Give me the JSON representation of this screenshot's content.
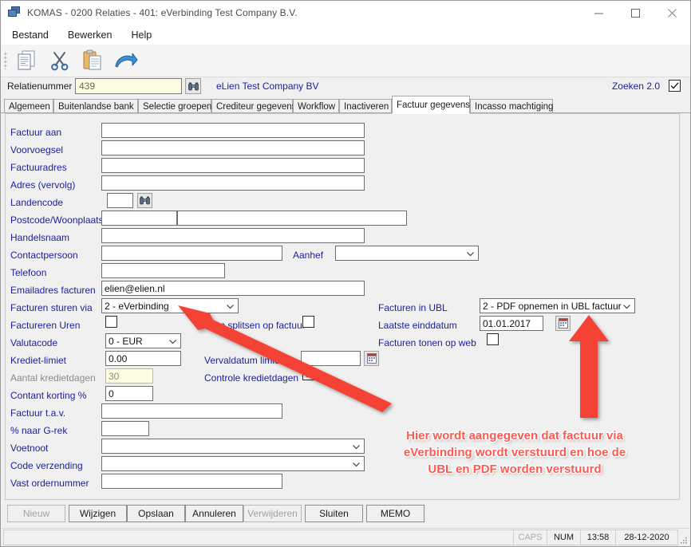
{
  "window": {
    "title": "KOMAS - 0200 Relaties - 401: eVerbinding Test Company B.V.",
    "icon": "app-window-icon",
    "minimize": "—",
    "maximize": "□",
    "close": "✕"
  },
  "menu": {
    "items": [
      {
        "label": "Bestand"
      },
      {
        "label": "Bewerken"
      },
      {
        "label": "Help"
      }
    ]
  },
  "toolbar": {
    "buttons": [
      {
        "name": "copy-documents-icon"
      },
      {
        "name": "scissors-cut-icon"
      },
      {
        "name": "clipboard-paste-icon"
      },
      {
        "name": "blue-arrow-undo-icon"
      }
    ]
  },
  "relation": {
    "label": "Relatienummer",
    "value": "439",
    "placeholder": "",
    "search_icon": "binoculars-icon",
    "company": "eLien Test Company BV",
    "zoeken_label": "Zoeken 2.0",
    "zoeken_checked": true
  },
  "tabs": [
    {
      "label": "Algemeen",
      "active": false
    },
    {
      "label": "Buitenlandse bank",
      "active": false
    },
    {
      "label": "Selectie groepen",
      "active": false
    },
    {
      "label": "Crediteur gegevens",
      "active": false
    },
    {
      "label": "Workflow",
      "active": false
    },
    {
      "label": "Inactiveren",
      "active": false
    },
    {
      "label": "Factuur gegevens",
      "active": true
    },
    {
      "label": "Incasso machtiging",
      "active": false
    }
  ],
  "form": {
    "left": [
      {
        "label": "Factuur aan",
        "type": "text",
        "value": ""
      },
      {
        "label": "Voorvoegsel",
        "type": "text",
        "value": ""
      },
      {
        "label": "Factuuradres",
        "type": "text",
        "value": ""
      },
      {
        "label": "Adres (vervolg)",
        "type": "text",
        "value": ""
      },
      {
        "label": "Landencode",
        "type": "text",
        "value": ""
      },
      {
        "label": "Postcode/Woonplaats",
        "type": "text",
        "value": ""
      },
      {
        "label": "Handelsnaam",
        "type": "text",
        "value": ""
      },
      {
        "label": "Contactpersoon",
        "type": "text",
        "value": ""
      },
      {
        "label": "Telefoon",
        "type": "text",
        "value": ""
      },
      {
        "label": "Emailadres facturen",
        "type": "text",
        "value": "elien@elien.nl"
      },
      {
        "label": "Facturen sturen via",
        "type": "select",
        "value": "2 - eVerbinding"
      },
      {
        "label": "Factureren Uren",
        "type": "check",
        "value": false
      },
      {
        "label": "Valutacode",
        "type": "select",
        "value": "0 - EUR"
      },
      {
        "label": "Krediet-limiet",
        "type": "text",
        "value": "0.00"
      },
      {
        "label": "Aantal kredietdagen",
        "type": "text",
        "value": "30",
        "readonly": true
      },
      {
        "label": "Contant korting %",
        "type": "text",
        "value": "0"
      },
      {
        "label": "Factuur t.a.v.",
        "type": "text",
        "value": ""
      },
      {
        "label": "% naar G-rek",
        "type": "text",
        "value": ""
      },
      {
        "label": "Voetnoot",
        "type": "select",
        "value": ""
      },
      {
        "label": "Code verzending",
        "type": "select",
        "value": ""
      },
      {
        "label": "Vast ordernummer",
        "type": "text",
        "value": ""
      }
    ],
    "postcode_second_value": "",
    "landencode_search_icon": "binoculars-icon",
    "aanhef": {
      "label": "Aanhef",
      "value": ""
    },
    "uren_splitsen": {
      "label": "Uren splitsen op factuur",
      "checked": false
    },
    "vervaldatum_limiet": {
      "label": "Vervaldatum limiet",
      "value": "",
      "picker_icon": "calendar-picker-icon"
    },
    "controle_kredietdagen": {
      "label": "Controle kredietdagen",
      "checked": true
    },
    "facturen_in_ubl": {
      "label": "Facturen in UBL",
      "value": "2 - PDF opnemen in UBL factuur"
    },
    "laatste_einddatum": {
      "label": "Laatste einddatum",
      "value": "01.01.2017",
      "picker_icon": "calendar-picker-icon"
    },
    "facturen_tonen_op_web": {
      "label": "Facturen tonen op web",
      "checked": false
    }
  },
  "annotation": {
    "text": "Hier wordt aangegeven dat factuur via eVerbinding wordt verstuurd en hoe de UBL en PDF worden verstuurd",
    "color": "#ff5a52",
    "arrows": [
      {
        "name": "arrow-to-facturen-sturen-via"
      },
      {
        "name": "arrow-to-facturen-in-ubl"
      }
    ]
  },
  "buttons": [
    {
      "label": "Nieuw",
      "disabled": true
    },
    {
      "label": "Wijzigen",
      "disabled": false
    },
    {
      "label": "Opslaan",
      "disabled": false
    },
    {
      "label": "Annuleren",
      "disabled": false
    },
    {
      "label": "Verwijderen",
      "disabled": true
    },
    {
      "label": "Sluiten",
      "disabled": false
    },
    {
      "label": "MEMO",
      "disabled": false
    }
  ],
  "statusbar": {
    "message": "",
    "caps": "CAPS",
    "num": "NUM",
    "time": "13:58",
    "date": "28-12-2020"
  }
}
